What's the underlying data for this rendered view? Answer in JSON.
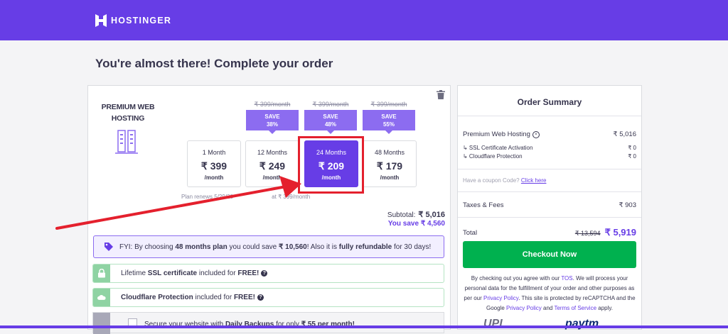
{
  "header": {
    "brand": "HOSTINGER"
  },
  "page_title": "You're almost there! Complete your order",
  "product": {
    "name_line1": "PREMIUM WEB",
    "name_line2": "HOSTING"
  },
  "plans": [
    {
      "period": "1 Month",
      "price": "₹ 399",
      "per": "/month"
    },
    {
      "period": "12 Months",
      "price": "₹ 249",
      "per": "/month",
      "old_price": "₹ 399/month",
      "save_label": "SAVE",
      "save_pct": "38%"
    },
    {
      "period": "24 Months",
      "price": "₹ 209",
      "per": "/month",
      "old_price": "₹ 399/month",
      "save_label": "SAVE",
      "save_pct": "48%",
      "selected": true
    },
    {
      "period": "48 Months",
      "price": "₹ 179",
      "per": "/month",
      "old_price": "₹ 399/month",
      "save_label": "SAVE",
      "save_pct": "55%"
    }
  ],
  "renew_note_a": "Plan renews 5/29/20",
  "renew_note_b": "at ₹ 399/month",
  "subtotal": {
    "label": "Subtotal:",
    "value": "₹ 5,016"
  },
  "you_save": "You save ₹ 4,560",
  "fyi": {
    "p1": "FYI: By choosing ",
    "b1": "48 months plan",
    "p2": " you could save ",
    "b2": "₹ 10,560",
    "p3": "! Also it is ",
    "b3": "fully refundable",
    "p4": " for 30 days!"
  },
  "features": {
    "ssl": {
      "p1": "Lifetime ",
      "b1": "SSL certificate",
      "p2": " included for ",
      "b2": "FREE!"
    },
    "cloudflare": {
      "b1": "Cloudflare Protection",
      "p1": " included for ",
      "b2": "FREE!"
    },
    "backup": {
      "p1": "Secure your website with ",
      "b1": "Daily Backups",
      "p2": " for only ",
      "b2": "₹ 55 per month!"
    }
  },
  "summary": {
    "title": "Order Summary",
    "item": {
      "label": "Premium Web Hosting",
      "value": "₹ 5,016"
    },
    "sub1": {
      "label": "↳ SSL Certificate Activation",
      "value": "₹ 0"
    },
    "sub2": {
      "label": "↳ Cloudflare Protection",
      "value": "₹ 0"
    },
    "coupon_q": "Have a coupon Code?",
    "coupon_link": "Click here",
    "taxes": {
      "label": "Taxes & Fees",
      "value": "₹ 903"
    },
    "total": {
      "label": "Total",
      "old": "₹ 13,594",
      "value": "₹ 5,919"
    },
    "checkout_label": "Checkout Now",
    "legal": {
      "p1": "By checking out you agree with our ",
      "tos": "TOS",
      "p2": ". We will process your personal data for the fulfillment of your order and other purposes as per our ",
      "privacy": "Privacy Policy",
      "p3": ". This site is protected by reCAPTCHA and the Google ",
      "privacy2": "Privacy Policy",
      "p4": " and ",
      "terms": "Terms of Service",
      "p5": " apply."
    }
  },
  "payment_logos": {
    "upi": "UPI",
    "paytm": "paytm"
  },
  "colors": {
    "brand": "#673de6",
    "checkout": "#00b14f",
    "highlight": "#e4202d"
  }
}
